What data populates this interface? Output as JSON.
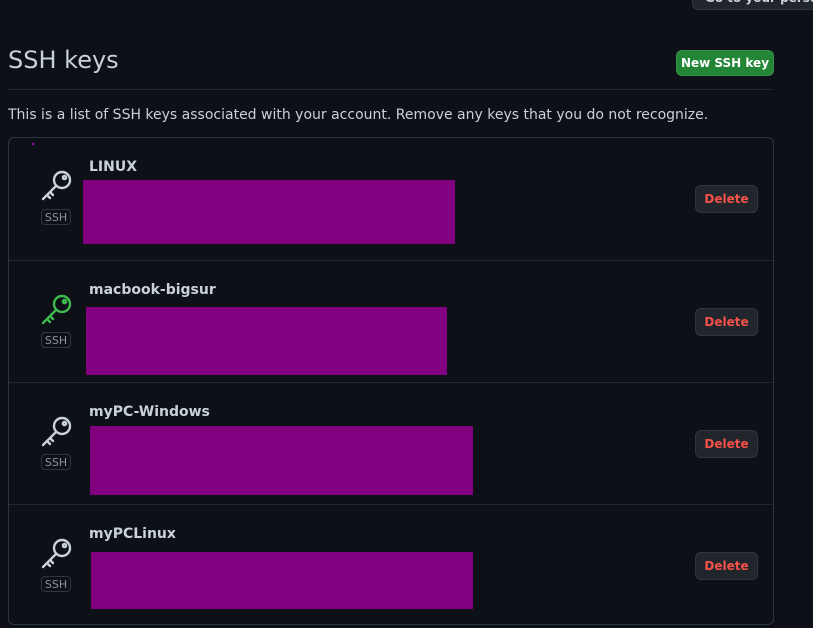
{
  "header": {
    "top_button_label": "Go to your personal profile",
    "title": "SSH keys",
    "new_key_label": "New SSH key",
    "description": "This is a list of SSH keys associated with your account. Remove any keys that you do not recognize."
  },
  "keys": [
    {
      "name": "LINUX",
      "type_label": "SSH",
      "delete_label": "Delete",
      "icon_color": "#c9d1d9"
    },
    {
      "name": "macbook-bigsur",
      "type_label": "SSH",
      "delete_label": "Delete",
      "icon_color": "#3fb950"
    },
    {
      "name": "myPC-Windows",
      "type_label": "SSH",
      "delete_label": "Delete",
      "icon_color": "#c9d1d9"
    },
    {
      "name": "myPCLinux",
      "type_label": "SSH",
      "delete_label": "Delete",
      "icon_color": "#c9d1d9"
    }
  ],
  "colors": {
    "background": "#0d1117",
    "primary_button": "#238636",
    "danger_text": "#f85149",
    "redaction": "#800080"
  }
}
